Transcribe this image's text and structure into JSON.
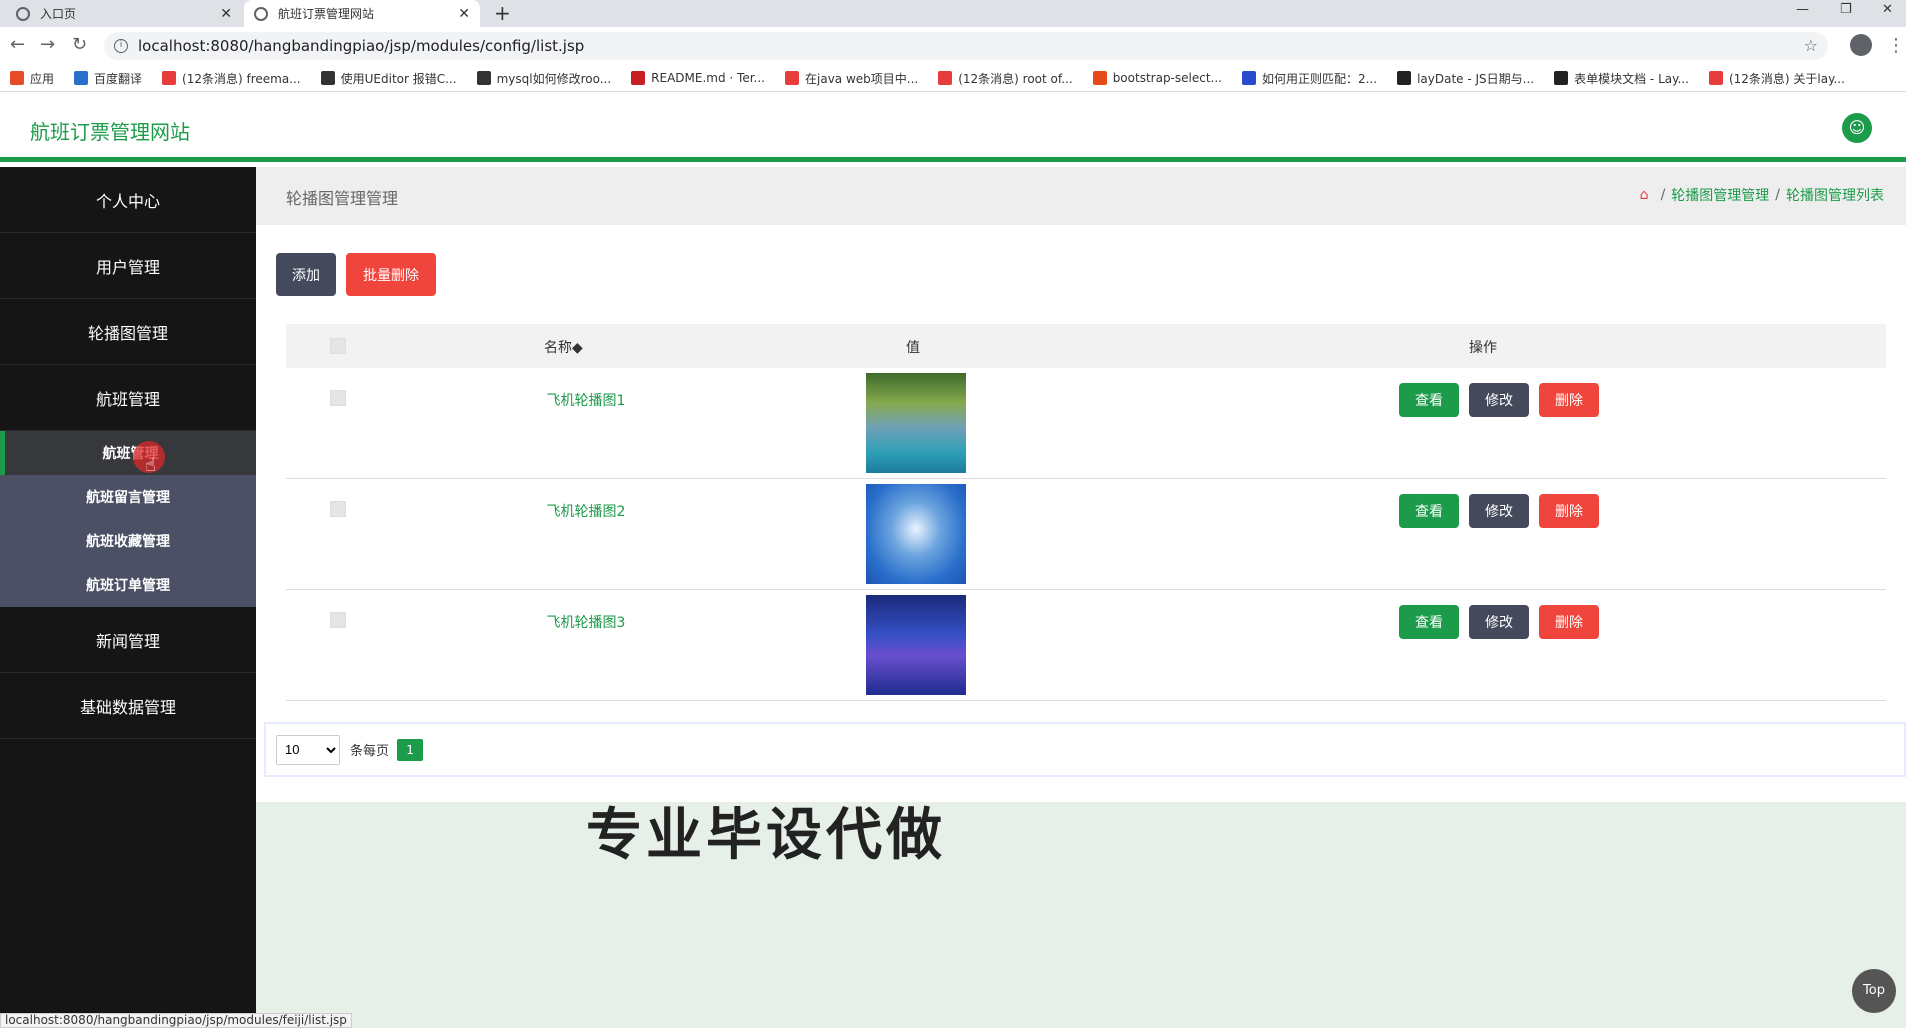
{
  "browser": {
    "tabs": [
      {
        "label": "入口页"
      },
      {
        "label": "航班订票管理网站"
      }
    ],
    "url": "localhost:8080/hangbandingpiao/jsp/modules/config/list.jsp",
    "bookmarks": [
      {
        "label": "应用",
        "color": "#e44d26"
      },
      {
        "label": "百度翻译",
        "color": "#2a6fcb"
      },
      {
        "label": "(12条消息) freema...",
        "color": "#e63c3c"
      },
      {
        "label": "使用UEditor 报错C...",
        "color": "#333333"
      },
      {
        "label": "mysql如何修改roo...",
        "color": "#333333"
      },
      {
        "label": "README.md · Ter...",
        "color": "#c71d23"
      },
      {
        "label": "在java web项目中...",
        "color": "#e63c3c"
      },
      {
        "label": "(12条消息) root of...",
        "color": "#e63c3c"
      },
      {
        "label": "bootstrap-select...",
        "color": "#e64a19"
      },
      {
        "label": "如何用正则匹配：2...",
        "color": "#2a4bd0"
      },
      {
        "label": "layDate - JS日期与...",
        "color": "#222222"
      },
      {
        "label": "表单模块文档 - Lay...",
        "color": "#222222"
      },
      {
        "label": "(12条消息) 关于lay...",
        "color": "#e63c3c"
      }
    ]
  },
  "header": {
    "brand": "航班订票管理网站"
  },
  "sidebar": {
    "items": [
      {
        "label": "个人中心"
      },
      {
        "label": "用户管理"
      },
      {
        "label": "轮播图管理"
      },
      {
        "label": "航班管理"
      }
    ],
    "sub_items": [
      {
        "label": "航班管理"
      },
      {
        "label": "航班留言管理"
      },
      {
        "label": "航班收藏管理"
      },
      {
        "label": "航班订单管理"
      }
    ],
    "items_after": [
      {
        "label": "新闻管理"
      },
      {
        "label": "基础数据管理"
      }
    ]
  },
  "content": {
    "title": "轮播图管理管理",
    "breadcrumb": [
      "轮播图管理管理",
      "轮播图管理列表"
    ],
    "add_label": "添加",
    "bulk_delete_label": "批量删除",
    "columns": {
      "name": "名称◆",
      "value": "值",
      "ops": "操作"
    },
    "rows": [
      {
        "name": "飞机轮播图1"
      },
      {
        "name": "飞机轮播图2"
      },
      {
        "name": "飞机轮播图3"
      }
    ],
    "view_label": "查看",
    "edit_label": "修改",
    "delete_label": "删除",
    "pager": {
      "page_size": "10",
      "per_page_label": "条每页",
      "current_page": "1"
    }
  },
  "watermark": "专业毕设代做",
  "top_button": "Top",
  "status_url": "localhost:8080/hangbandingpiao/jsp/modules/feiji/list.jsp",
  "colors": {
    "accent": "#1c9b4a",
    "danger": "#f0453c",
    "dark": "#444a5c"
  }
}
